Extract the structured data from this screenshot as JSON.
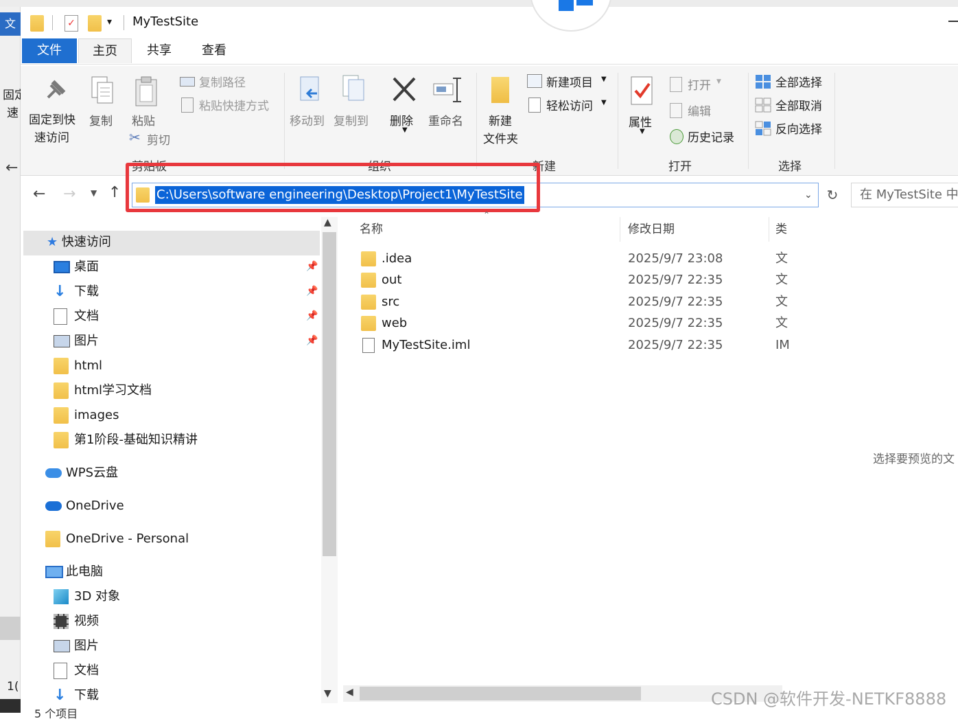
{
  "window": {
    "title": "MyTestSite"
  },
  "background_window": {
    "tab_label": "文",
    "items": [
      "固定",
      "速",
      "1("
    ]
  },
  "tabs": {
    "file": "文件",
    "home": "主页",
    "share": "共享",
    "view": "查看"
  },
  "ribbon": {
    "clipboard": {
      "group_label": "剪贴板",
      "pin_line1": "固定到快",
      "pin_line2": "速访问",
      "copy": "复制",
      "paste": "粘贴",
      "copy_path": "复制路径",
      "paste_shortcut": "粘贴快捷方式",
      "cut": "剪切"
    },
    "organize": {
      "group_label": "组织",
      "move_to": "移动到",
      "copy_to": "复制到",
      "delete": "删除",
      "rename": "重命名"
    },
    "new": {
      "group_label": "新建",
      "new_folder_line1": "新建",
      "new_folder_line2": "文件夹",
      "new_item": "新建项目",
      "easy_access": "轻松访问"
    },
    "open": {
      "group_label": "打开",
      "properties": "属性",
      "open": "打开",
      "edit": "编辑",
      "history": "历史记录"
    },
    "select": {
      "group_label": "选择",
      "select_all": "全部选择",
      "select_none": "全部取消",
      "invert": "反向选择"
    }
  },
  "address": {
    "path": "C:\\Users\\software engineering\\Desktop\\Project1\\MyTestSite",
    "search_placeholder": "在 MyTestSite 中"
  },
  "nav": {
    "quick_access": "快速访问",
    "pinned": [
      {
        "label": "桌面",
        "icon": "desktop-icon"
      },
      {
        "label": "下载",
        "icon": "download-icon"
      },
      {
        "label": "文档",
        "icon": "document-icon"
      },
      {
        "label": "图片",
        "icon": "picture-icon"
      }
    ],
    "folders": [
      "html",
      "html学习文档",
      "images",
      "第1阶段-基础知识精讲"
    ],
    "wps": "WPS云盘",
    "onedrive": "OneDrive",
    "onedrive_personal": "OneDrive - Personal",
    "this_pc": "此电脑",
    "pc_items": [
      {
        "label": "3D 对象",
        "icon": "3d-objects-icon"
      },
      {
        "label": "视频",
        "icon": "video-icon"
      },
      {
        "label": "图片",
        "icon": "picture-icon"
      },
      {
        "label": "文档",
        "icon": "document-icon"
      },
      {
        "label": "下载",
        "icon": "download-icon"
      }
    ]
  },
  "columns": {
    "name": "名称",
    "date": "修改日期",
    "type": "类"
  },
  "files": [
    {
      "name": ".idea",
      "date": "2025/9/7 23:08",
      "type": "文",
      "kind": "folder"
    },
    {
      "name": "out",
      "date": "2025/9/7 22:35",
      "type": "文",
      "kind": "folder"
    },
    {
      "name": "src",
      "date": "2025/9/7 22:35",
      "type": "文",
      "kind": "folder"
    },
    {
      "name": "web",
      "date": "2025/9/7 22:35",
      "type": "文",
      "kind": "folder"
    },
    {
      "name": "MyTestSite.iml",
      "date": "2025/9/7 22:35",
      "type": "IM",
      "kind": "file"
    }
  ],
  "status": {
    "count": "5 个项目"
  },
  "preview_message": "选择要预览的文",
  "watermark": "CSDN @软件开发-NETKF8888",
  "colors": {
    "accent": "#1f6fd0",
    "selection": "#0a64d8",
    "highlight_box": "#e8383d",
    "folder": "#f1c04a"
  }
}
